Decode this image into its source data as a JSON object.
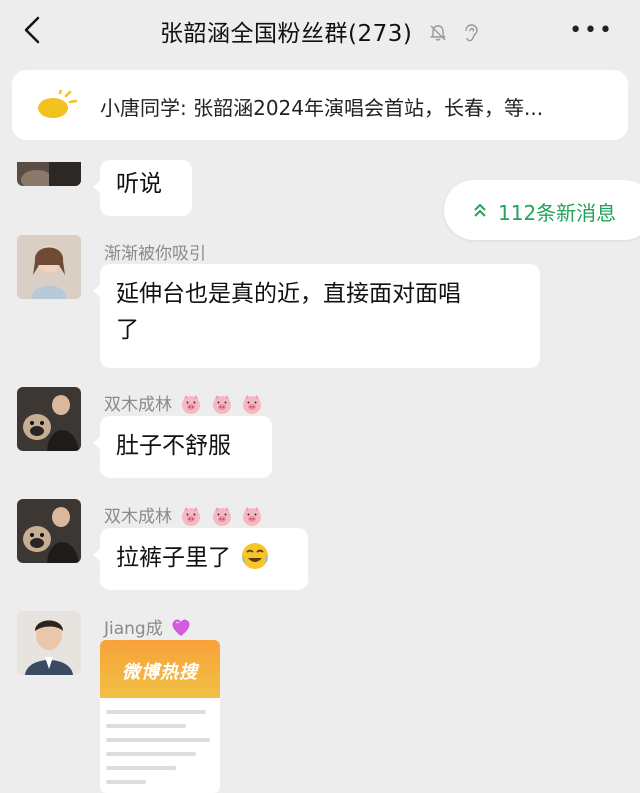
{
  "header": {
    "title": "张韶涵全国粉丝群(273)",
    "more_label": "•••"
  },
  "announcement": {
    "text": "小唐同学: 张韶涵2024年演唱会首站，长春，等..."
  },
  "new_messages": {
    "label": "112条新消息"
  },
  "messages": [
    {
      "sender": "",
      "text": "听说"
    },
    {
      "sender": "渐渐被你吸引",
      "text_line1": "延伸台也是真的近，直接面对面唱",
      "text_line2": "了"
    },
    {
      "sender": "双木成林",
      "text": "肚子不舒服"
    },
    {
      "sender": "双木成林",
      "text": "拉裤子里了"
    },
    {
      "sender": "Jiang成",
      "image_banner": "微博热搜"
    }
  ],
  "colors": {
    "background": "#ededed",
    "accent_green": "#21a35a",
    "sender_gray": "#8a8a8a"
  },
  "icons": [
    "back-arrow-icon",
    "mute-bell-icon",
    "ear-icon",
    "more-icon",
    "bulb-icon",
    "double-up-arrow-icon",
    "pig-emoji-icon",
    "crying-laugh-emoji-icon",
    "heart-emoji-icon"
  ]
}
